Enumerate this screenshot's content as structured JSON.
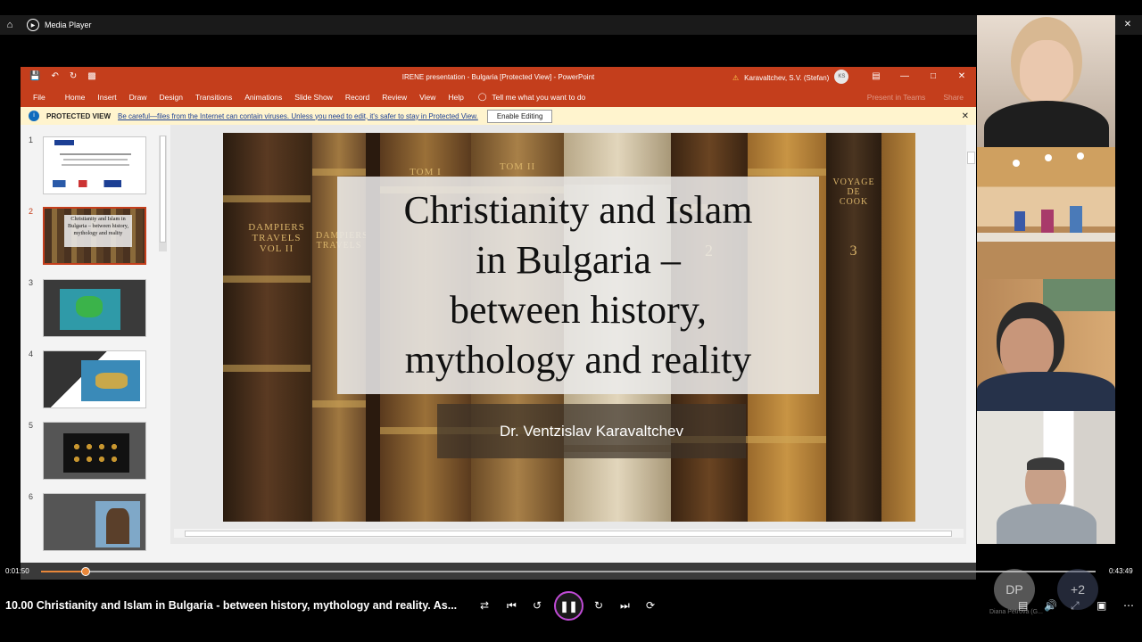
{
  "player": {
    "app_name": "Media Player",
    "elapsed": "0:01:50",
    "duration": "0:43:49",
    "progress": 0.042,
    "media_title": "10.00 Christianity and Islam in Bulgaria - between history, mythology and reality. As..."
  },
  "ppt": {
    "window_title": "IRENE presentation - Bulgaria [Protected View]  -  PowerPoint",
    "user_name": "Karavaltchev, S.V. (Stefan)",
    "user_initials": "KS",
    "tabs": [
      "File",
      "Home",
      "Insert",
      "Draw",
      "Design",
      "Transitions",
      "Animations",
      "Slide Show",
      "Record",
      "Review",
      "View",
      "Help"
    ],
    "tell_me": "Tell me what you want to do",
    "ribbon_right": [
      "Present in Teams",
      "Share"
    ],
    "protected_label": "PROTECTED VIEW",
    "protected_msg": "Be careful—files from the Internet can contain viruses. Unless you need to edit, it's safer to stay in Protected View.",
    "enable_editing": "Enable Editing",
    "slide_numbers": [
      "1",
      "2",
      "3",
      "4",
      "5",
      "6"
    ],
    "thumb2_text": "Christianity and Islam in Bulgaria – between history, mythology and reality"
  },
  "slide": {
    "title": "Christianity and Islam\nin Bulgaria –\nbetween history,\nmythology and reality",
    "author": "Dr. Ventzislav Karavaltchev",
    "spines": [
      "DAMPIERS TRAVELS VOL II",
      "DAMPIERS TRAVELS",
      "TOM I",
      "TOM II",
      "VOYAGE DE COOK",
      "3",
      "2"
    ]
  },
  "participants": {
    "overlay_initials": "DP",
    "overlay_name": "Diana Petrova (G...",
    "overlay_more": "+2"
  }
}
